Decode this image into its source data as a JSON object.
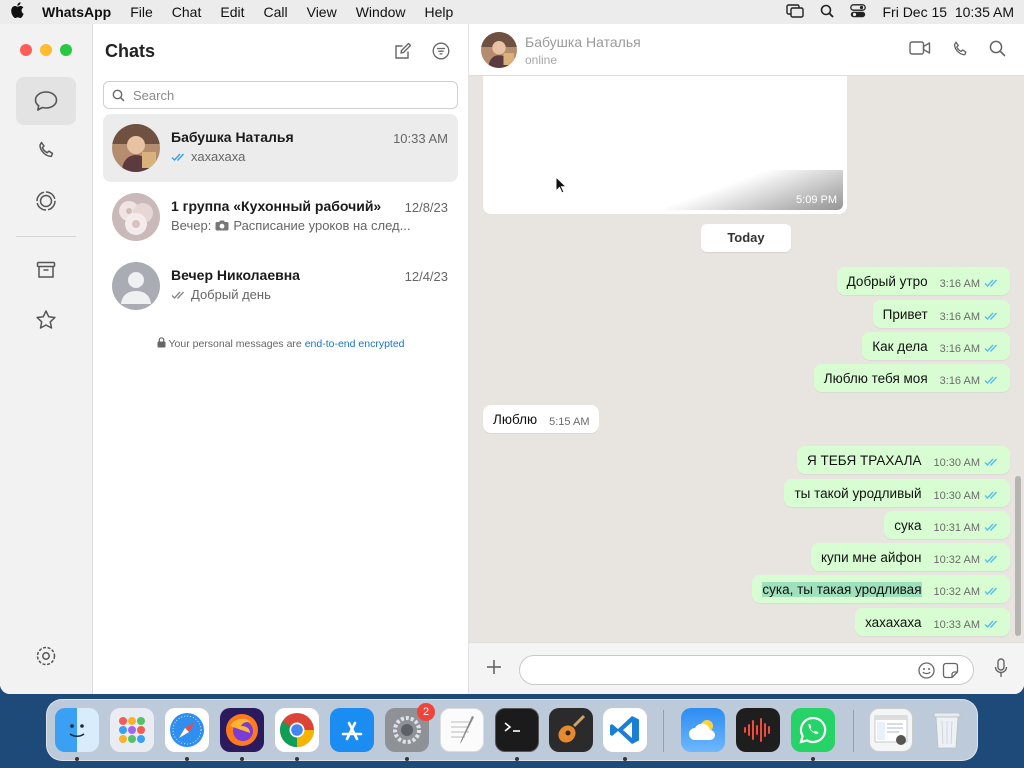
{
  "menubar": {
    "app": "WhatsApp",
    "items": [
      "File",
      "Chat",
      "Edit",
      "Call",
      "View",
      "Window",
      "Help"
    ],
    "clock": "Fri Dec 15  10:35 AM"
  },
  "sidebar": {
    "title": "Chats",
    "search_placeholder": "Search",
    "chats": [
      {
        "name": "Бабушка Наталья",
        "time": "10:33 AM",
        "preview": "хахахаха"
      },
      {
        "name": "1 группа «Кухонный рабочий»",
        "time": "12/8/23",
        "sender": "Вечер:",
        "preview": "Расписание уроков на след..."
      },
      {
        "name": "Вечер Николаевна",
        "time": "12/4/23",
        "preview": "Добрый день"
      }
    ],
    "encryption_note": "Your personal messages are ",
    "encryption_link": "end-to-end encrypted"
  },
  "conversation": {
    "contact_name": "Бабушка Наталья",
    "status": "online",
    "image_time": "5:09 PM",
    "day_divider": "Today",
    "messages": [
      {
        "dir": "out",
        "text": "Добрый утро",
        "time": "3:16 AM"
      },
      {
        "dir": "out",
        "text": "Привет",
        "time": "3:16 AM"
      },
      {
        "dir": "out",
        "text": "Как дела",
        "time": "3:16 AM"
      },
      {
        "dir": "out",
        "text": "Люблю тебя моя",
        "time": "3:16 AM"
      },
      {
        "dir": "in",
        "text": "Люблю",
        "time": "5:15 AM"
      },
      {
        "dir": "out",
        "text": "Я ТЕБЯ ТРАХАЛА",
        "time": "10:30 AM"
      },
      {
        "dir": "out",
        "text": "ты такой уродливый",
        "time": "10:30 AM"
      },
      {
        "dir": "out",
        "text": "сука",
        "time": "10:31 AM"
      },
      {
        "dir": "out",
        "text": "купи мне айфон",
        "time": "10:32 AM"
      },
      {
        "dir": "out",
        "text": "сука, ты такая уродливая",
        "time": "10:32 AM"
      },
      {
        "dir": "out",
        "text": "хахахаха",
        "time": "10:33 AM"
      }
    ],
    "composer_value": ""
  },
  "dock": {
    "apps": [
      "finder",
      "launchpad",
      "safari",
      "firefox",
      "chrome",
      "app-store",
      "system-settings",
      "textedit",
      "terminal",
      "garageband",
      "vscode",
      "weather",
      "voice-memos",
      "whatsapp",
      "preview",
      "trash"
    ],
    "settings_badge": "2"
  },
  "colors": {
    "outgoing_bubble": "#d9fdd3",
    "incoming_bubble": "#ffffff",
    "link": "#1a73c8",
    "chat_background": "#e8e5e0"
  }
}
